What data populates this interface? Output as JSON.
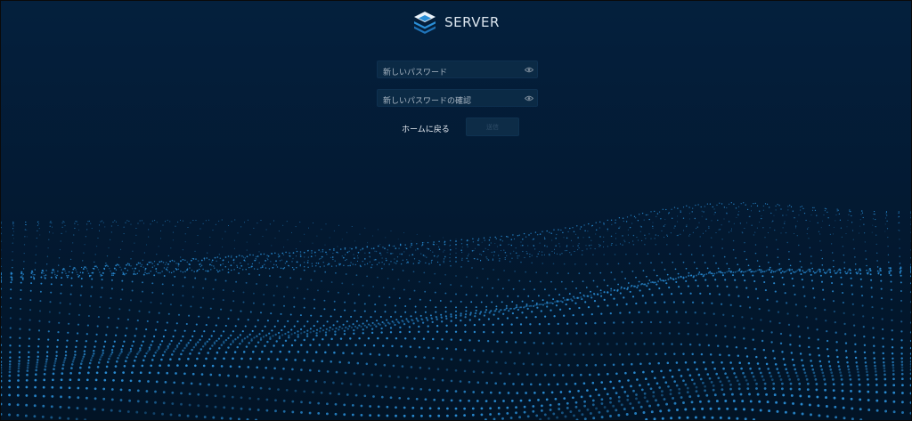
{
  "app": {
    "brand": "SERVER"
  },
  "form": {
    "new_password": {
      "placeholder": "新しいパスワード",
      "value": ""
    },
    "confirm_password": {
      "placeholder": "新しいパスワードの確認",
      "value": ""
    }
  },
  "actions": {
    "home_link": "ホームに戻る",
    "submit_label": "送信"
  },
  "icons": {
    "logo": "stacked-layers-icon",
    "eye": "eye-icon"
  },
  "colors": {
    "background": "#03182e",
    "accent": "#2a8fd8",
    "field": "#0b2a45",
    "text": "#e9eef4"
  }
}
